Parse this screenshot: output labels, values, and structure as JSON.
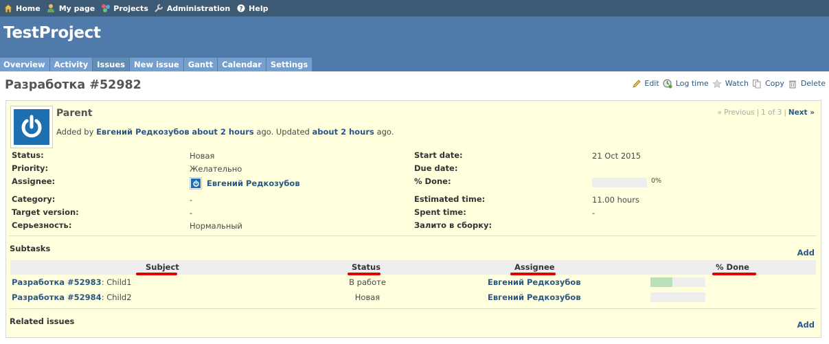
{
  "top_menu": {
    "items": [
      {
        "label": "Home",
        "icon": "home-icon"
      },
      {
        "label": "My page",
        "icon": "user-icon"
      },
      {
        "label": "Projects",
        "icon": "projects-icon"
      },
      {
        "label": "Administration",
        "icon": "wrench-icon"
      },
      {
        "label": "Help",
        "icon": "help-icon"
      }
    ]
  },
  "project": {
    "name": "TestProject"
  },
  "main_menu": {
    "tabs": [
      {
        "label": "Overview"
      },
      {
        "label": "Activity"
      },
      {
        "label": "Issues",
        "selected": true
      },
      {
        "label": "New issue"
      },
      {
        "label": "Gantt"
      },
      {
        "label": "Calendar"
      },
      {
        "label": "Settings"
      }
    ]
  },
  "page": {
    "title": "Разработка #52982"
  },
  "contextual": {
    "edit": "Edit",
    "log_time": "Log time",
    "watch": "Watch",
    "copy": "Copy",
    "delete": "Delete"
  },
  "issue": {
    "subject": "Parent",
    "added_by_prefix": "Added by",
    "author": "Евгений Редкозубов",
    "added_ago": "about 2 hours",
    "ago_updated": "ago. Updated",
    "updated_ago": "about 2 hours",
    "ago_end": "ago.",
    "nav": {
      "previous": "« Previous",
      "counter": "1 of 3",
      "next": "Next »"
    },
    "attributes": {
      "status_label": "Status:",
      "status": "Новая",
      "priority_label": "Priority:",
      "priority": "Желательно",
      "assignee_label": "Assignee:",
      "assignee": "Евгений Редкозубов",
      "category_label": "Category:",
      "category": "-",
      "target_label": "Target version:",
      "target": "-",
      "severity_label": "Серьезность:",
      "severity": "Нормальный",
      "start_label": "Start date:",
      "start": "21 Oct 2015",
      "due_label": "Due date:",
      "due": "",
      "done_label": "% Done:",
      "done": "0%",
      "done_fraction": 0,
      "estimated_label": "Estimated time:",
      "estimated": "11.00 hours",
      "spent_label": "Spent time:",
      "spent": "-",
      "build_label": "Залито в сборку:",
      "build": ""
    }
  },
  "subtasks": {
    "title": "Subtasks",
    "add": "Add",
    "headers": {
      "subject": "Subject",
      "status": "Status",
      "assignee": "Assignee",
      "done": "% Done"
    },
    "rows": [
      {
        "link": "Разработка #52983",
        "name": ": Child1",
        "status": "В работе",
        "assignee": "Евгений Редкозубов",
        "done_fraction": 0.4
      },
      {
        "link": "Разработка #52984",
        "name": ": Child2",
        "status": "Новая",
        "assignee": "Евгений Редкозубов",
        "done_fraction": 0
      }
    ]
  },
  "related": {
    "title": "Related issues",
    "add": "Add"
  },
  "colors": {
    "top_menu_bg": "#3e5b76",
    "header_bg": "#507aaa",
    "tab_bg": "#759fcf",
    "issue_bg": "#ffffdd",
    "link": "#2a5685",
    "annotation": "#e00000"
  }
}
